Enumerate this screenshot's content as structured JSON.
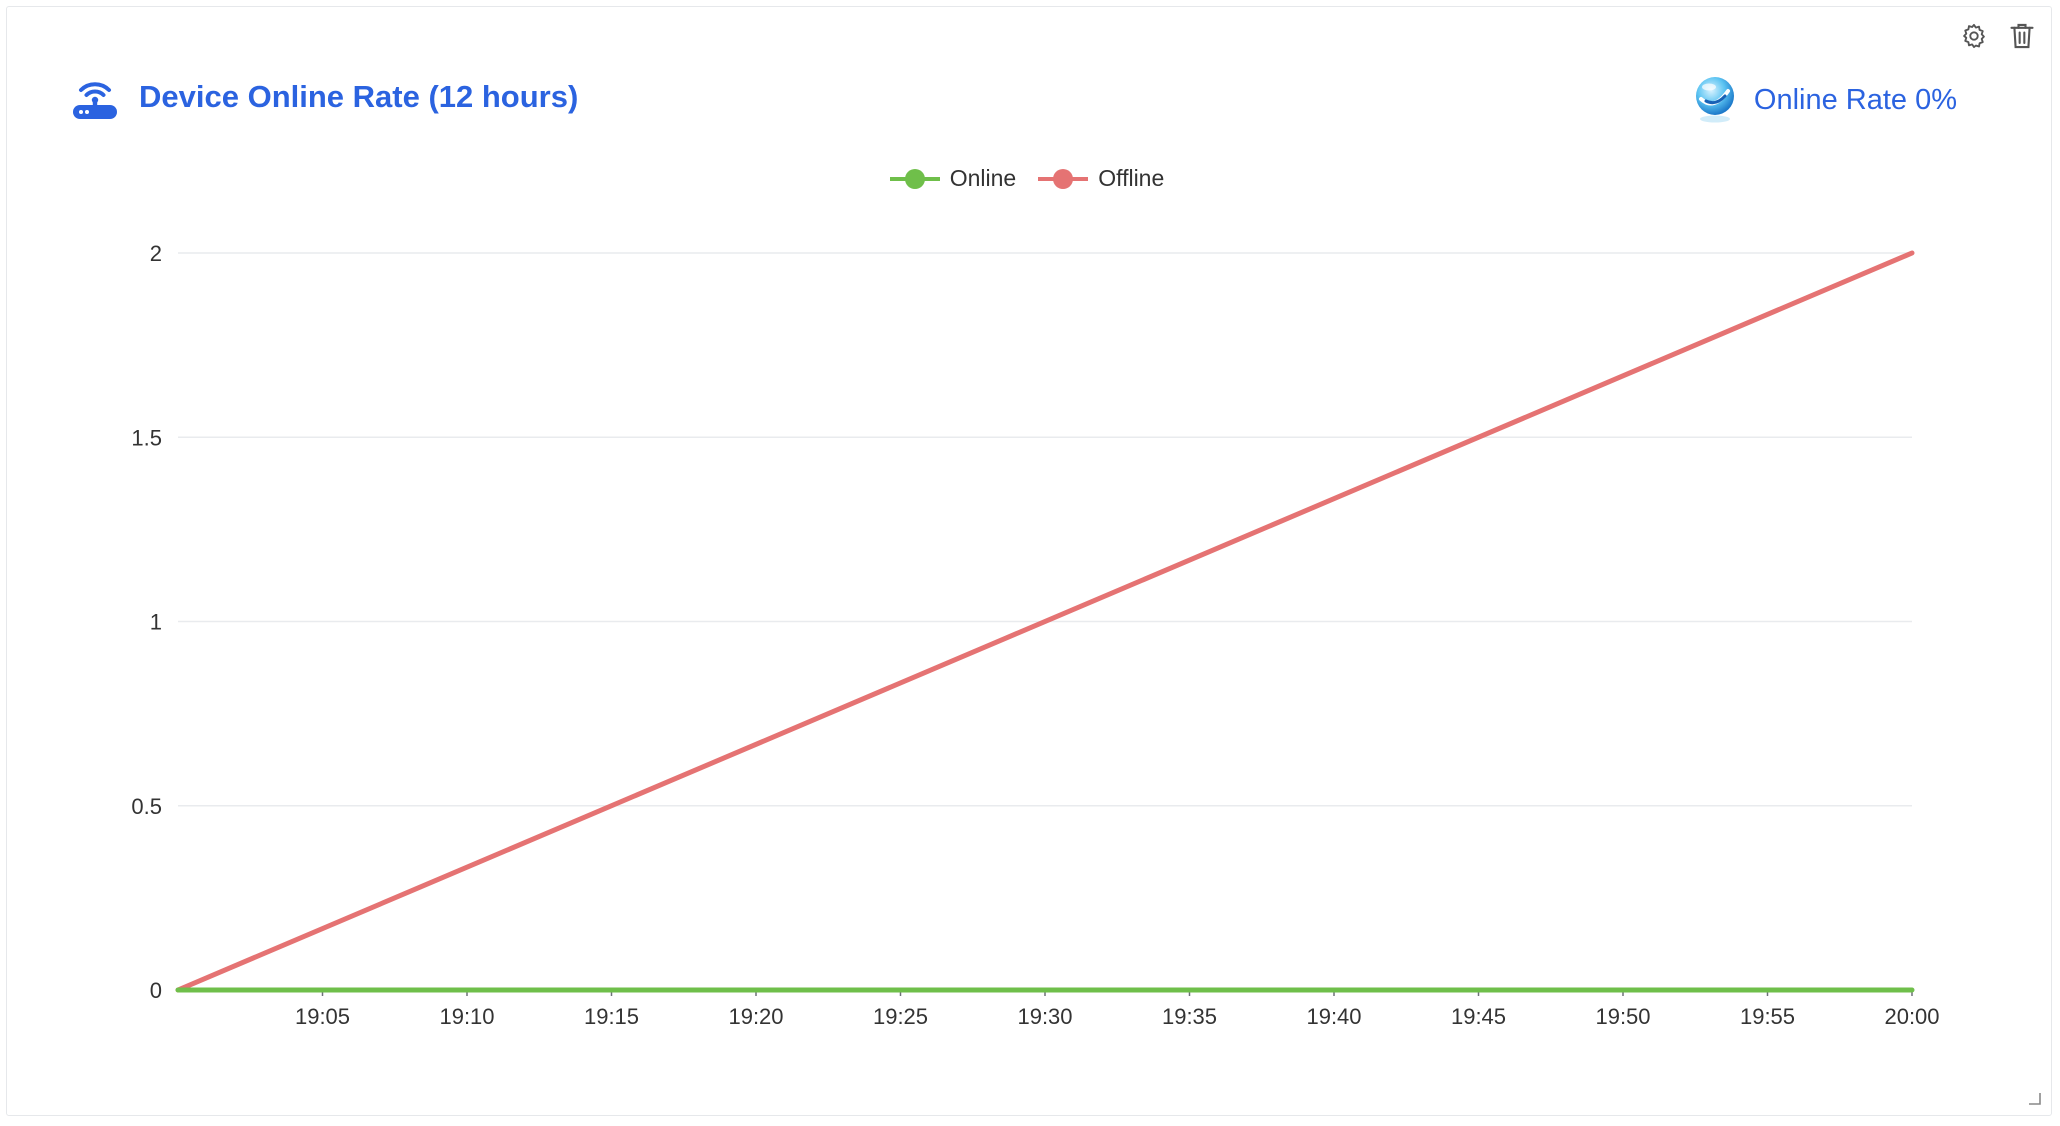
{
  "header": {
    "title": "Device Online Rate (12 hours)",
    "rate_label": "Online Rate",
    "rate_value": "0%"
  },
  "icons": {
    "title_icon": "router-wifi-icon",
    "rate_icon": "glossy-globe-icon",
    "settings": "gear-icon",
    "delete": "trash-icon",
    "resize": "resize-handle-icon"
  },
  "colors": {
    "accent": "#2b63e0",
    "online": "#6fbf4a",
    "offline": "#e57373",
    "grid": "#e9ebee",
    "axis_text": "#333333"
  },
  "chart_data": {
    "type": "line",
    "x": [
      "19:00",
      "20:00"
    ],
    "tick_labels": [
      "19:05",
      "19:10",
      "19:15",
      "19:20",
      "19:25",
      "19:30",
      "19:35",
      "19:40",
      "19:45",
      "19:50",
      "19:55",
      "20:00"
    ],
    "x_range_minutes": [
      0,
      60
    ],
    "y_ticks": [
      "0",
      "0.5",
      "1",
      "1.5",
      "2"
    ],
    "ylim": [
      0,
      2
    ],
    "grid": true,
    "legend": "top-center",
    "series": [
      {
        "name": "Online",
        "color": "#6fbf4a",
        "points": [
          [
            0,
            0
          ],
          [
            60,
            0
          ]
        ]
      },
      {
        "name": "Offline",
        "color": "#e57373",
        "points": [
          [
            0,
            0
          ],
          [
            60,
            2
          ]
        ]
      }
    ]
  }
}
